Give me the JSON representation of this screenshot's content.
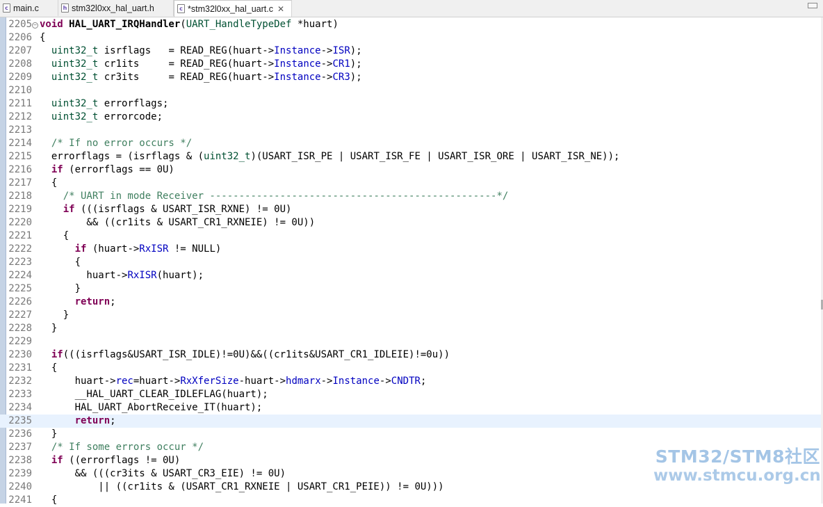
{
  "tabs": [
    {
      "label": "main.c",
      "icon": "c-file-icon",
      "icon_letter": "c"
    },
    {
      "label": "stm32l0xx_hal_uart.h",
      "icon": "h-file-icon",
      "icon_letter": "h"
    },
    {
      "label": "*stm32l0xx_hal_uart.c",
      "icon": "c-file-icon",
      "icon_letter": "c",
      "active": true,
      "close": "✕"
    }
  ],
  "editor": {
    "current_line": 2235,
    "lines": [
      {
        "n": "2205",
        "fold": "−",
        "t": [
          [
            "kw",
            "void"
          ],
          [
            "",
            ""
          ],
          [
            "bd",
            " HAL_UART_IRQHandler"
          ],
          [
            "",
            "("
          ],
          [
            "ty",
            "UART_HandleTypeDef"
          ],
          [
            "",
            " *huart)"
          ]
        ]
      },
      {
        "n": "2206",
        "t": [
          [
            "",
            "{"
          ]
        ]
      },
      {
        "n": "2207",
        "t": [
          [
            "",
            "  "
          ],
          [
            "ty",
            "uint32_t"
          ],
          [
            "",
            " isrflags   = READ_REG(huart->"
          ],
          [
            "fd",
            "Instance"
          ],
          [
            "",
            "->"
          ],
          [
            "fd",
            "ISR"
          ],
          [
            "",
            ");"
          ]
        ]
      },
      {
        "n": "2208",
        "t": [
          [
            "",
            "  "
          ],
          [
            "ty",
            "uint32_t"
          ],
          [
            "",
            " cr1its     = READ_REG(huart->"
          ],
          [
            "fd",
            "Instance"
          ],
          [
            "",
            "->"
          ],
          [
            "fd",
            "CR1"
          ],
          [
            "",
            ");"
          ]
        ]
      },
      {
        "n": "2209",
        "t": [
          [
            "",
            "  "
          ],
          [
            "ty",
            "uint32_t"
          ],
          [
            "",
            " cr3its     = READ_REG(huart->"
          ],
          [
            "fd",
            "Instance"
          ],
          [
            "",
            "->"
          ],
          [
            "fd",
            "CR3"
          ],
          [
            "",
            ");"
          ]
        ]
      },
      {
        "n": "2210",
        "t": []
      },
      {
        "n": "2211",
        "t": [
          [
            "",
            "  "
          ],
          [
            "ty",
            "uint32_t"
          ],
          [
            "",
            " errorflags;"
          ]
        ]
      },
      {
        "n": "2212",
        "t": [
          [
            "",
            "  "
          ],
          [
            "ty",
            "uint32_t"
          ],
          [
            "",
            " errorcode;"
          ]
        ]
      },
      {
        "n": "2213",
        "t": []
      },
      {
        "n": "2214",
        "t": [
          [
            "",
            "  "
          ],
          [
            "cm",
            "/* If no error occurs */"
          ]
        ]
      },
      {
        "n": "2215",
        "t": [
          [
            "",
            "  errorflags = (isrflags & ("
          ],
          [
            "ty",
            "uint32_t"
          ],
          [
            "",
            ")(USART_ISR_PE | USART_ISR_FE | USART_ISR_ORE | USART_ISR_NE));"
          ]
        ]
      },
      {
        "n": "2216",
        "t": [
          [
            "",
            "  "
          ],
          [
            "kw",
            "if"
          ],
          [
            "",
            " (errorflags == 0U)"
          ]
        ]
      },
      {
        "n": "2217",
        "t": [
          [
            "",
            "  {"
          ]
        ]
      },
      {
        "n": "2218",
        "t": [
          [
            "",
            "    "
          ],
          [
            "cm",
            "/* UART in mode Receiver -------------------------------------------------*/"
          ]
        ]
      },
      {
        "n": "2219",
        "t": [
          [
            "",
            "    "
          ],
          [
            "kw",
            "if"
          ],
          [
            "",
            " (((isrflags & USART_ISR_RXNE) != 0U)"
          ]
        ]
      },
      {
        "n": "2220",
        "t": [
          [
            "",
            "        && ((cr1its & USART_CR1_RXNEIE) != 0U))"
          ]
        ]
      },
      {
        "n": "2221",
        "t": [
          [
            "",
            "    {"
          ]
        ]
      },
      {
        "n": "2222",
        "t": [
          [
            "",
            "      "
          ],
          [
            "kw",
            "if"
          ],
          [
            "",
            " (huart->"
          ],
          [
            "fd",
            "RxISR"
          ],
          [
            "",
            " != NULL)"
          ]
        ]
      },
      {
        "n": "2223",
        "t": [
          [
            "",
            "      {"
          ]
        ]
      },
      {
        "n": "2224",
        "t": [
          [
            "",
            "        huart->"
          ],
          [
            "fd",
            "RxISR"
          ],
          [
            "",
            "(huart);"
          ]
        ]
      },
      {
        "n": "2225",
        "t": [
          [
            "",
            "      }"
          ]
        ]
      },
      {
        "n": "2226",
        "t": [
          [
            "",
            "      "
          ],
          [
            "kw",
            "return"
          ],
          [
            "",
            ";"
          ]
        ]
      },
      {
        "n": "2227",
        "t": [
          [
            "",
            "    }"
          ]
        ]
      },
      {
        "n": "2228",
        "t": [
          [
            "",
            "  }"
          ]
        ]
      },
      {
        "n": "2229",
        "t": []
      },
      {
        "n": "2230",
        "t": [
          [
            "",
            "  "
          ],
          [
            "kw",
            "if"
          ],
          [
            "",
            "(((isrflags&USART_ISR_IDLE)!=0U)&&((cr1its&USART_CR1_IDLEIE)!=0u))"
          ]
        ]
      },
      {
        "n": "2231",
        "t": [
          [
            "",
            "  {"
          ]
        ]
      },
      {
        "n": "2232",
        "t": [
          [
            "",
            "      huart->"
          ],
          [
            "fd",
            "rec"
          ],
          [
            "",
            "=huart->"
          ],
          [
            "fd",
            "RxXferSize"
          ],
          [
            "",
            "-huart->"
          ],
          [
            "fd",
            "hdmarx"
          ],
          [
            "",
            "->"
          ],
          [
            "fd",
            "Instance"
          ],
          [
            "",
            "->"
          ],
          [
            "fd",
            "CNDTR"
          ],
          [
            "",
            ";"
          ]
        ]
      },
      {
        "n": "2233",
        "t": [
          [
            "",
            "      __HAL_UART_CLEAR_IDLEFLAG(huart);"
          ]
        ]
      },
      {
        "n": "2234",
        "t": [
          [
            "",
            "      HAL_UART_AbortReceive_IT(huart);"
          ]
        ]
      },
      {
        "n": "2235",
        "t": [
          [
            "",
            "      "
          ],
          [
            "kw",
            "return"
          ],
          [
            "",
            ";"
          ]
        ]
      },
      {
        "n": "2236",
        "t": [
          [
            "",
            "  }"
          ]
        ]
      },
      {
        "n": "2237",
        "t": [
          [
            "",
            "  "
          ],
          [
            "cm",
            "/* If some errors occur */"
          ]
        ]
      },
      {
        "n": "2238",
        "t": [
          [
            "",
            "  "
          ],
          [
            "kw",
            "if"
          ],
          [
            "",
            " ((errorflags != 0U)"
          ]
        ]
      },
      {
        "n": "2239",
        "t": [
          [
            "",
            "      && (((cr3its & USART_CR3_EIE) != 0U)"
          ]
        ]
      },
      {
        "n": "2240",
        "t": [
          [
            "",
            "          || ((cr1its & (USART_CR1_RXNEIE | USART_CR1_PEIE)) != 0U)))"
          ]
        ]
      },
      {
        "n": "2241",
        "t": [
          [
            "",
            "  {"
          ]
        ]
      }
    ]
  },
  "watermark": {
    "line1": "STM32/STM8社区",
    "line2": "www.stmcu.org.cn"
  },
  "colors": {
    "keyword": "#7f0055",
    "type": "#005032",
    "field": "#0000c0",
    "comment": "#3f7f5f",
    "current_line": "#e8f2fe"
  }
}
